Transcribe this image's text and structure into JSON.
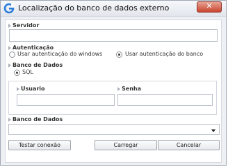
{
  "window": {
    "title": "Localização do banco de dados externo",
    "close_glyph": "✕"
  },
  "servidor": {
    "label": "Servidor",
    "value": ""
  },
  "autenticacao": {
    "label": "Autenticação",
    "option_windows": "Usar autenticação do windows",
    "option_banco": "Usar autenticação do banco",
    "selected": "banco"
  },
  "banco_tipo": {
    "label": "Banco de Dados",
    "option_sql": "SQL",
    "selected": "SQL"
  },
  "credenciais": {
    "usuario_label": "Usuario",
    "usuario_value": "",
    "senha_label": "Senha",
    "senha_value": ""
  },
  "banco_select": {
    "label": "Banco de Dados",
    "value": ""
  },
  "buttons": {
    "test": "Testar conexão",
    "load": "Carregar",
    "cancel": "Cancelar"
  },
  "colors": {
    "close_button": "#c9452f",
    "title_icon": "#2a7bd8"
  }
}
